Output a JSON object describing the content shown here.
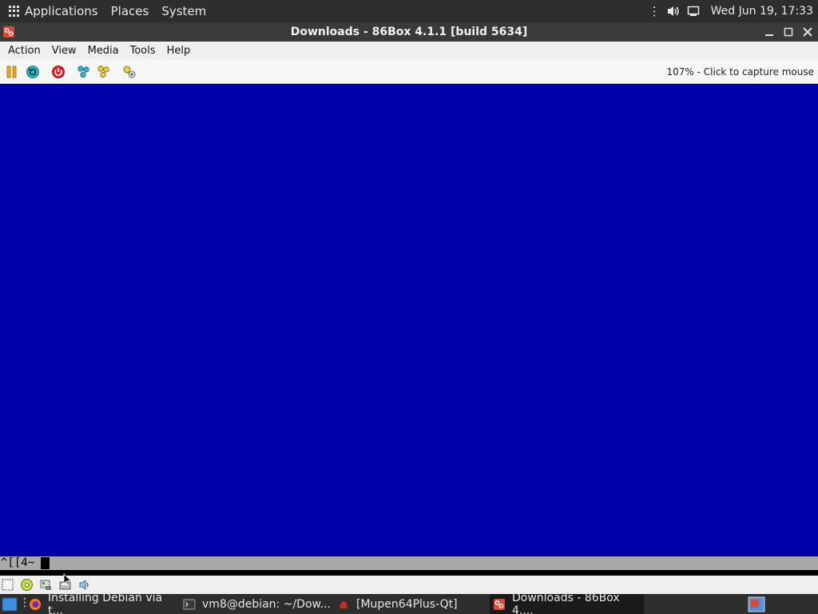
{
  "top_panel": {
    "menus": [
      "Applications",
      "Places",
      "System"
    ],
    "tray_icons": [
      "more-vert-icon",
      "volume-icon",
      "network-icon"
    ],
    "clock": "Wed Jun 19, 17:33"
  },
  "window": {
    "title": "Downloads - 86Box 4.1.1 [build 5634]",
    "controls": [
      "minimize-icon",
      "maximize-icon",
      "close-icon"
    ]
  },
  "menubar": {
    "items": [
      "Action",
      "View",
      "Media",
      "Tools",
      "Help"
    ]
  },
  "toolbar": {
    "buttons": [
      "pause-icon",
      "reset-icon",
      "power-icon",
      "ctrl-alt-del-icon",
      "ctrl-alt-esc-icon",
      "settings-icon"
    ],
    "status": "107% - Click to capture mouse"
  },
  "emulator": {
    "screen_color": "#0000a8",
    "console_text": "^[[4~"
  },
  "statusbar": {
    "icons": [
      "floppy-icon",
      "cdrom-icon",
      "network-card-icon",
      "hard-disk-icon",
      "sound-icon"
    ]
  },
  "taskbar": {
    "tasks": [
      {
        "icon": "firefox-icon",
        "label": "Installing Debian via t..."
      },
      {
        "icon": "terminal-icon",
        "label": "vm8@debian: ~/Dow..."
      },
      {
        "icon": "mupen-icon",
        "label": "[Mupen64Plus-Qt]"
      },
      {
        "icon": "86box-icon",
        "label": "Downloads - 86Box 4...."
      }
    ],
    "active_task": 3
  }
}
